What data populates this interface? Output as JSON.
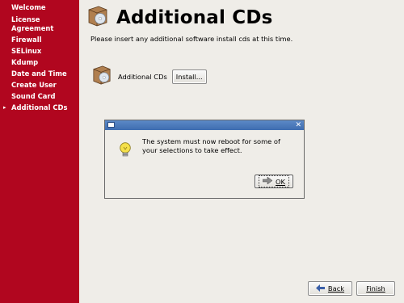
{
  "sidebar": {
    "items": [
      {
        "label": "Welcome",
        "current": false
      },
      {
        "label": "License Agreement",
        "current": false
      },
      {
        "label": "Firewall",
        "current": false
      },
      {
        "label": "SELinux",
        "current": false
      },
      {
        "label": "Kdump",
        "current": false
      },
      {
        "label": "Date and Time",
        "current": false
      },
      {
        "label": "Create User",
        "current": false
      },
      {
        "label": "Sound Card",
        "current": false
      },
      {
        "label": "Additional CDs",
        "current": true
      }
    ],
    "current_marker": "▸"
  },
  "main": {
    "title": "Additional CDs",
    "instruction": "Please insert any additional software install cds at this time.",
    "cd_label": "Additional CDs",
    "install_button": "Install..."
  },
  "dialog": {
    "close_glyph": "✕",
    "message": "The system must now reboot for some of your selections to take effect.",
    "ok_button": "OK"
  },
  "footer": {
    "back_button": "Back",
    "finish_button": "Finish"
  },
  "colors": {
    "sidebar_bg": "#b1061f",
    "titlebar": "#4a78bb"
  }
}
